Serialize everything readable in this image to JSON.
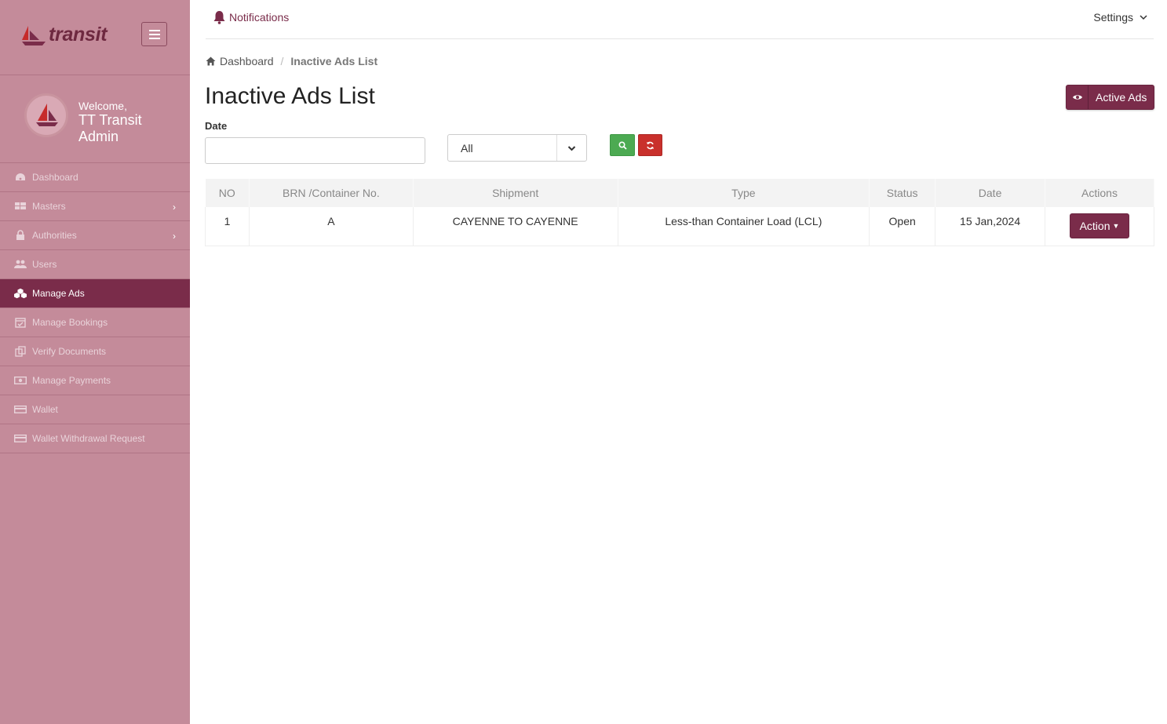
{
  "app": {
    "logo_text": "transit",
    "brand_color": "#7a2c4a",
    "sidebar_color": "#c48b9a"
  },
  "profile": {
    "greeting": "Welcome,",
    "name_line1": "TT Transit",
    "name_line2": "Admin"
  },
  "sidebar": {
    "items": [
      {
        "label": "Dashboard",
        "icon": "dashboard-icon",
        "has_submenu": false,
        "active": false
      },
      {
        "label": "Masters",
        "icon": "table-icon",
        "has_submenu": true,
        "active": false
      },
      {
        "label": "Authorities",
        "icon": "lock-icon",
        "has_submenu": true,
        "active": false
      },
      {
        "label": "Users",
        "icon": "users-icon",
        "has_submenu": false,
        "active": false
      },
      {
        "label": "Manage Ads",
        "icon": "cubes-icon",
        "has_submenu": false,
        "active": true
      },
      {
        "label": "Manage Bookings",
        "icon": "calendar-check-icon",
        "has_submenu": false,
        "active": false
      },
      {
        "label": "Verify Documents",
        "icon": "documents-icon",
        "has_submenu": false,
        "active": false
      },
      {
        "label": "Manage Payments",
        "icon": "money-icon",
        "has_submenu": false,
        "active": false
      },
      {
        "label": "Wallet",
        "icon": "credit-card-icon",
        "has_submenu": false,
        "active": false
      },
      {
        "label": "Wallet Withdrawal Request",
        "icon": "credit-card-icon",
        "has_submenu": false,
        "active": false
      }
    ]
  },
  "topbar": {
    "notifications_label": "Notifications",
    "settings_label": "Settings"
  },
  "breadcrumb": {
    "home": "Dashboard",
    "current": "Inactive Ads List"
  },
  "page": {
    "title": "Inactive Ads List",
    "active_ads_button": "Active Ads"
  },
  "filters": {
    "date_label": "Date",
    "date_value": "",
    "date_placeholder": "",
    "status_select_value": "All"
  },
  "table": {
    "headers": [
      "NO",
      "BRN /Container No.",
      "Shipment",
      "Type",
      "Status",
      "Date",
      "Actions"
    ],
    "rows": [
      {
        "no": "1",
        "brn": "A",
        "shipment": "CAYENNE TO CAYENNE",
        "type": "Less-than Container Load (LCL)",
        "status": "Open",
        "date": "15 Jan,2024",
        "action_label": "Action"
      }
    ]
  }
}
